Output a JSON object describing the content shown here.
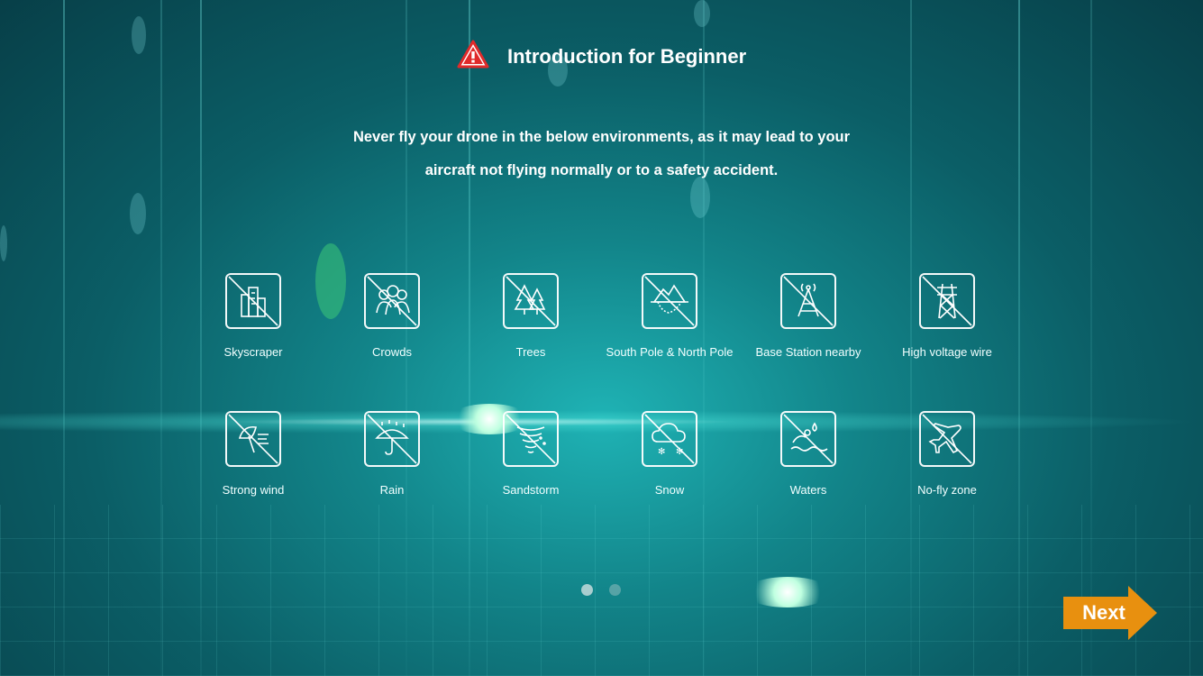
{
  "header": {
    "title": "Introduction for Beginner",
    "warning_icon": "warning-triangle-icon"
  },
  "intro": {
    "line1": "Never fly your drone in the below environments, as it may lead to your",
    "line2": "aircraft not flying normally or to a safety accident."
  },
  "environments": [
    {
      "label": "Skyscraper",
      "icon": "skyscraper-icon"
    },
    {
      "label": "Crowds",
      "icon": "crowds-icon"
    },
    {
      "label": "Trees",
      "icon": "trees-icon"
    },
    {
      "label": "South Pole & North Pole",
      "icon": "iceberg-icon"
    },
    {
      "label": "Base Station nearby",
      "icon": "base-station-icon"
    },
    {
      "label": "High voltage wire",
      "icon": "power-tower-icon"
    },
    {
      "label": "Strong wind",
      "icon": "strong-wind-icon"
    },
    {
      "label": "Rain",
      "icon": "rain-umbrella-icon"
    },
    {
      "label": "Sandstorm",
      "icon": "sandstorm-icon"
    },
    {
      "label": "Snow",
      "icon": "snow-cloud-icon"
    },
    {
      "label": "Waters",
      "icon": "waters-icon"
    },
    {
      "label": "No-fly zone",
      "icon": "airplane-icon"
    }
  ],
  "pagination": {
    "active_page": 1,
    "total_pages": 2
  },
  "next_button": {
    "label": "Next"
  },
  "colors": {
    "accent": "#e8900f",
    "warning_red": "#e02a2a",
    "text": "#ffffff"
  }
}
